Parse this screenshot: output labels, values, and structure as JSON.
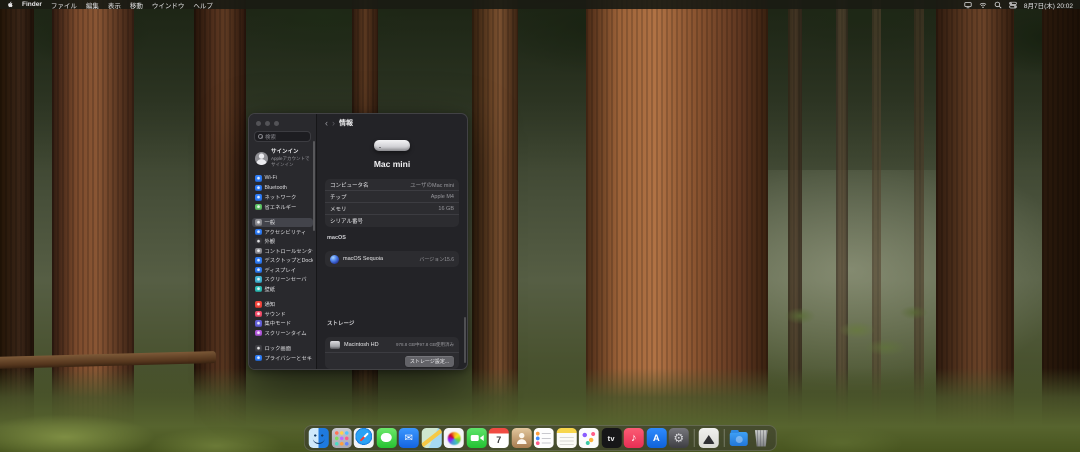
{
  "colors": {
    "menu_bar_bg": "#1a1b14",
    "window_bg": "#232327",
    "sidebar_selected": "#43444b",
    "accent_blue": "#2e7cf6",
    "card_bg": "#2c2c30",
    "secondary_text": "#98989d"
  },
  "menu_bar": {
    "app_name": "Finder",
    "menus": [
      "ファイル",
      "編集",
      "表示",
      "移動",
      "ウインドウ",
      "ヘルプ"
    ],
    "status_icons": [
      "display-icon",
      "wifi-icon",
      "search-icon",
      "control-center-icon"
    ],
    "clock": "8月7日(木) 20:02"
  },
  "settings_window": {
    "search_placeholder": "検索",
    "profile": {
      "title": "サインイン",
      "subtitle": "Appleアカウントでサインイン"
    },
    "sidebar_items": [
      {
        "label": "Wi-Fi"
      },
      {
        "label": "Bluetooth"
      },
      {
        "label": "ネットワーク"
      },
      {
        "label": "省エネルギー"
      },
      {
        "label": "一般"
      },
      {
        "label": "アクセシビリティ"
      },
      {
        "label": "外観"
      },
      {
        "label": "コントロールセンター"
      },
      {
        "label": "デスクトップとDock"
      },
      {
        "label": "ディスプレイ"
      },
      {
        "label": "スクリーンセーバ"
      },
      {
        "label": "壁紙"
      },
      {
        "label": "通知"
      },
      {
        "label": "サウンド"
      },
      {
        "label": "集中モード"
      },
      {
        "label": "スクリーンタイム"
      },
      {
        "label": "ロック画面"
      },
      {
        "label": "プライバシーとセキュリティ"
      }
    ],
    "content": {
      "nav_title": "情報",
      "back_chevron": "‹",
      "forward_chevron": "›",
      "device_name": "Mac mini",
      "info_rows": [
        {
          "label": "コンピュータ名",
          "value": "ユーザのMac mini"
        },
        {
          "label": "チップ",
          "value": "Apple M4"
        },
        {
          "label": "メモリ",
          "value": "16 GB"
        },
        {
          "label": "シリアル番号",
          "value": ""
        }
      ],
      "macos": {
        "header": "macOS",
        "name": "macOS Sequoia",
        "version": "バージョン15.6"
      },
      "storage": {
        "header": "ストレージ",
        "disk_name": "Macintosh HD",
        "usage": "978.8 GB中97.8 GB使用済み",
        "settings_button": "ストレージ設定..."
      }
    }
  },
  "dock": {
    "items": [
      "finder",
      "launchpad",
      "safari",
      "messages",
      "mail",
      "maps",
      "photos",
      "facetime",
      "calendar",
      "contacts",
      "reminders",
      "notes",
      "freeform",
      "tv",
      "music",
      "app-store",
      "system-settings",
      "app",
      "downloads-folder",
      "trash"
    ],
    "calendar_day": "7",
    "tv_glyph": "tv",
    "mail_glyph": "✉",
    "music_glyph": "♪",
    "appstore_glyph": "A",
    "settings_glyph": "⚙"
  }
}
